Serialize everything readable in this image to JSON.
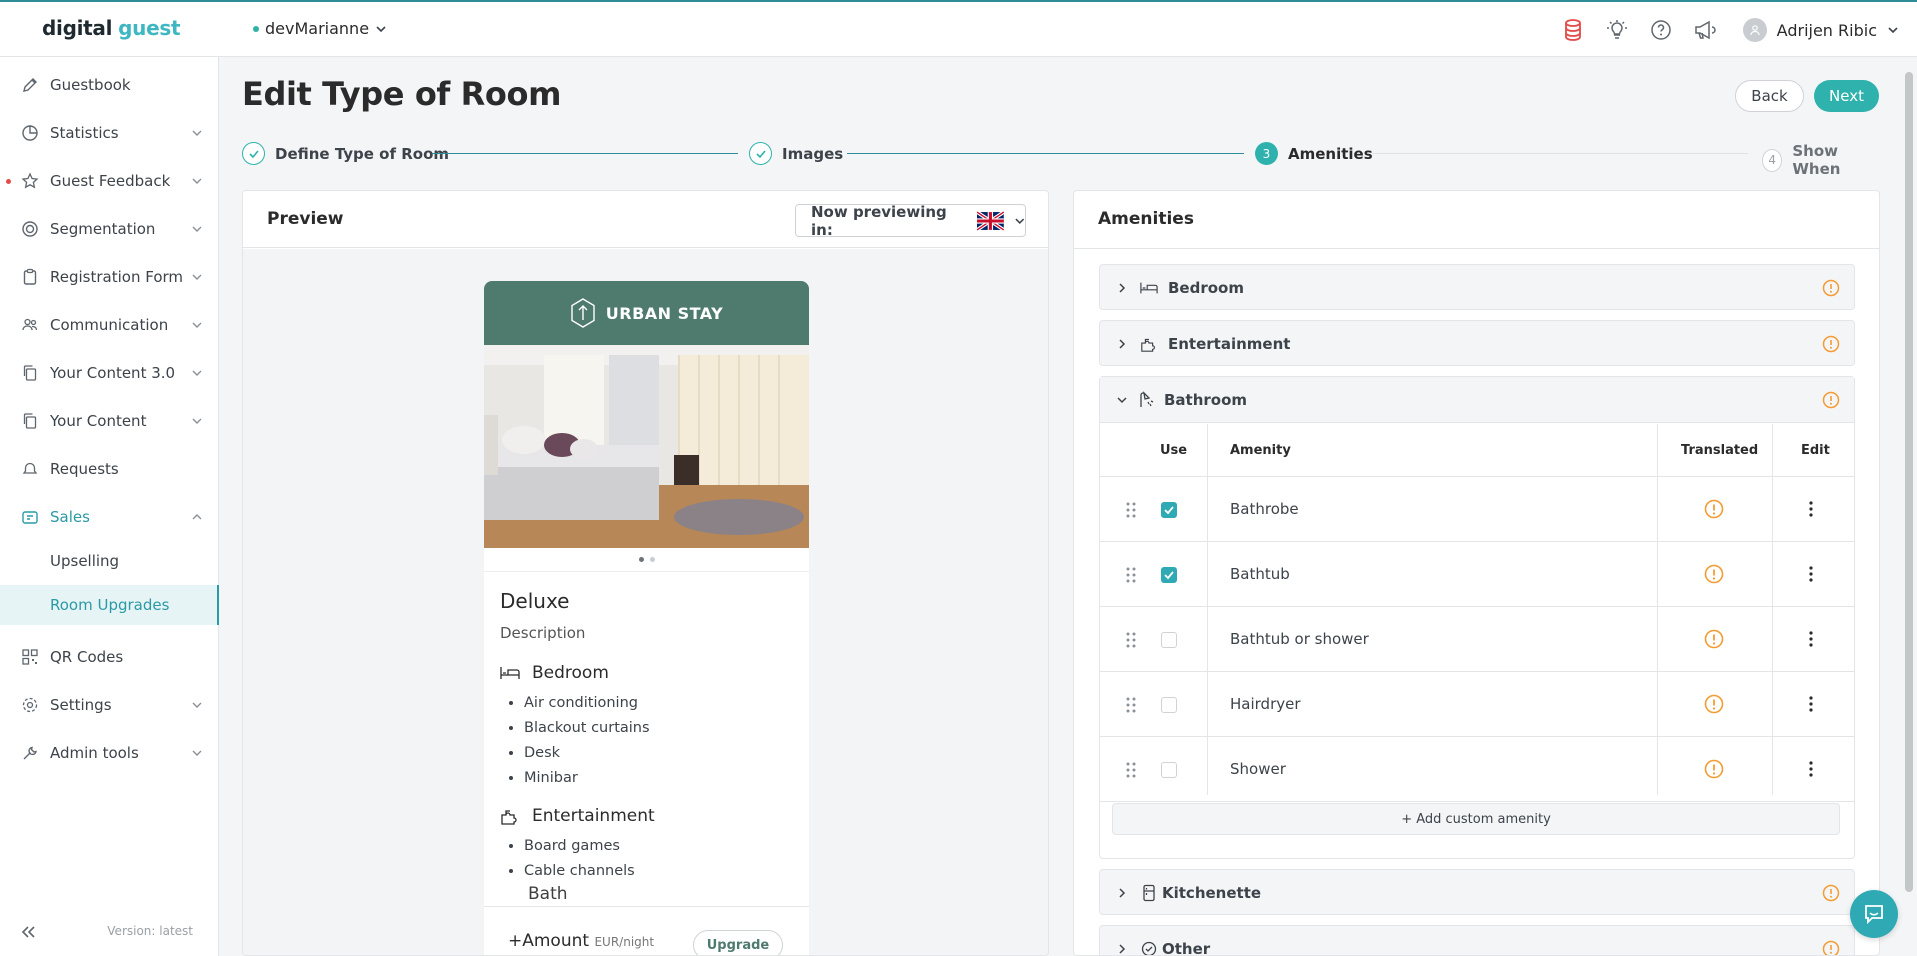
{
  "header": {
    "logo_part1": "digital",
    "logo_part2": "guest",
    "environment": "devMarianne",
    "user_name": "Adrijen Ribic",
    "icons": [
      "database-icon",
      "lightbulb-icon",
      "help-icon",
      "megaphone-icon"
    ]
  },
  "sidebar": {
    "items": [
      {
        "label": "Guestbook",
        "icon": "pencil-icon"
      },
      {
        "label": "Statistics",
        "icon": "pie-chart-icon"
      },
      {
        "label": "Guest Feedback",
        "icon": "star-icon"
      },
      {
        "label": "Segmentation",
        "icon": "target-icon"
      },
      {
        "label": "Registration Form",
        "icon": "clipboard-icon"
      },
      {
        "label": "Communication",
        "icon": "users-icon"
      },
      {
        "label": "Your Content 3.0",
        "icon": "copy-icon"
      },
      {
        "label": "Your Content",
        "icon": "copy-icon"
      },
      {
        "label": "Requests",
        "icon": "bell-icon"
      },
      {
        "label": "Sales",
        "icon": "tag-icon"
      },
      {
        "label": "QR Codes",
        "icon": "qr-icon"
      },
      {
        "label": "Settings",
        "icon": "gear-icon"
      },
      {
        "label": "Admin tools",
        "icon": "wrench-icon"
      }
    ],
    "sub_items": [
      "Upselling",
      "Room Upgrades"
    ],
    "version": "Version: latest"
  },
  "page": {
    "title": "Edit Type of Room",
    "back_label": "Back",
    "next_label": "Next"
  },
  "stepper": {
    "steps": [
      {
        "label": "Define Type of Room",
        "state": "done"
      },
      {
        "label": "Images",
        "state": "done"
      },
      {
        "number": "3",
        "label": "Amenities",
        "state": "current"
      },
      {
        "number": "4",
        "label": "Show When",
        "state": "todo"
      }
    ]
  },
  "preview": {
    "title": "Preview",
    "language_label": "Now previewing in:",
    "language_flag": "uk-flag",
    "phone": {
      "brand": "URBAN STAY",
      "room_name": "Deluxe",
      "description": "Description",
      "categories": [
        {
          "name": "Bedroom",
          "items": [
            "Air conditioning",
            "Blackout curtains",
            "Desk",
            "Minibar"
          ]
        },
        {
          "name": "Entertainment",
          "items": [
            "Board games",
            "Cable channels"
          ]
        }
      ],
      "partial_category": "Bath",
      "amount": "+Amount",
      "unit": "EUR/night",
      "upgrade_label": "Upgrade"
    }
  },
  "amenities": {
    "title": "Amenities",
    "categories": [
      {
        "name": "Bedroom"
      },
      {
        "name": "Entertainment"
      },
      {
        "name": "Bathroom"
      },
      {
        "name": "Kitchenette"
      },
      {
        "name": "Other"
      }
    ],
    "columns": {
      "use": "Use",
      "amenity": "Amenity",
      "translated": "Translated",
      "edit": "Edit"
    },
    "bathroom_rows": [
      {
        "name": "Bathrobe",
        "used": true
      },
      {
        "name": "Bathtub",
        "used": true
      },
      {
        "name": "Bathtub or shower",
        "used": false
      },
      {
        "name": "Hairdryer",
        "used": false
      },
      {
        "name": "Shower",
        "used": false
      }
    ],
    "add_custom_label": "+ Add custom amenity"
  },
  "colors": {
    "accent": "#2fb2ad",
    "warning": "#f39c34",
    "brand_green": "#4f7a6e",
    "alert_red": "#e44b4b"
  }
}
